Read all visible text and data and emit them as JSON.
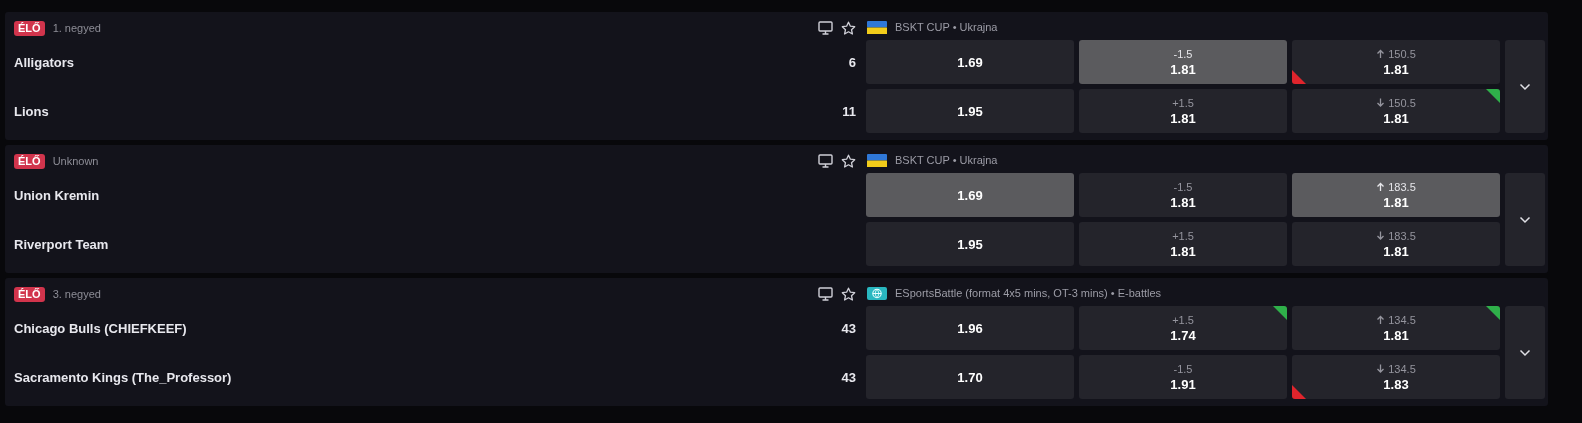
{
  "matches": [
    {
      "status": "ÉLŐ",
      "period": "1. negyed",
      "league_flag": true,
      "league": "BSKT CUP • Ukrajna",
      "teams": [
        {
          "name": "Alligators",
          "score": "6"
        },
        {
          "name": "Lions",
          "score": "11"
        }
      ],
      "rows": [
        [
          {
            "kind": "win",
            "odds": "1.69",
            "selected": false,
            "rising": false,
            "falling": false
          },
          {
            "kind": "handicap",
            "line": "-1.5",
            "odds": "1.81",
            "selected": true,
            "rising": false,
            "falling": false
          },
          {
            "kind": "over",
            "line": "150.5",
            "odds": "1.81",
            "selected": false,
            "rising": false,
            "falling": true
          }
        ],
        [
          {
            "kind": "win",
            "odds": "1.95",
            "selected": false,
            "rising": false,
            "falling": false
          },
          {
            "kind": "handicap",
            "line": "+1.5",
            "odds": "1.81",
            "selected": false,
            "rising": false,
            "falling": false
          },
          {
            "kind": "under",
            "line": "150.5",
            "odds": "1.81",
            "selected": false,
            "rising": true,
            "falling": false
          }
        ]
      ]
    },
    {
      "status": "ÉLŐ",
      "period": "Unknown",
      "league_flag": true,
      "league": "BSKT CUP • Ukrajna",
      "teams": [
        {
          "name": "Union Kremin"
        },
        {
          "name": "Riverport Team"
        }
      ],
      "rows": [
        [
          {
            "kind": "win",
            "odds": "1.69",
            "selected": true,
            "rising": false,
            "falling": false
          },
          {
            "kind": "handicap",
            "line": "-1.5",
            "odds": "1.81",
            "selected": false,
            "rising": false,
            "falling": false
          },
          {
            "kind": "over",
            "line": "183.5",
            "odds": "1.81",
            "selected": true,
            "rising": false,
            "falling": false
          }
        ],
        [
          {
            "kind": "win",
            "odds": "1.95",
            "selected": false,
            "rising": false,
            "falling": false
          },
          {
            "kind": "handicap",
            "line": "+1.5",
            "odds": "1.81",
            "selected": false,
            "rising": false,
            "falling": false
          },
          {
            "kind": "under",
            "line": "183.5",
            "odds": "1.81",
            "selected": false,
            "rising": false,
            "falling": false
          }
        ]
      ]
    },
    {
      "status": "ÉLŐ",
      "period": "3. negyed",
      "league_flag": false,
      "league": "ESportsBattle (format 4x5 mins, OT-3 mins) • E-battles",
      "teams": [
        {
          "name": "Chicago Bulls (CHIEFKEEF)",
          "score": "43"
        },
        {
          "name": "Sacramento Kings (The_Professor)",
          "score": "43"
        }
      ],
      "rows": [
        [
          {
            "kind": "win",
            "odds": "1.96",
            "selected": false,
            "rising": false,
            "falling": false
          },
          {
            "kind": "handicap",
            "line": "+1.5",
            "odds": "1.74",
            "selected": false,
            "rising": true,
            "falling": false
          },
          {
            "kind": "over",
            "line": "134.5",
            "odds": "1.81",
            "selected": false,
            "rising": true,
            "falling": false
          }
        ],
        [
          {
            "kind": "win",
            "odds": "1.70",
            "selected": false,
            "rising": false,
            "falling": false
          },
          {
            "kind": "handicap",
            "line": "-1.5",
            "odds": "1.91",
            "selected": false,
            "rising": false,
            "falling": false
          },
          {
            "kind": "under",
            "line": "134.5",
            "odds": "1.83",
            "selected": false,
            "rising": false,
            "falling": true
          }
        ]
      ]
    }
  ]
}
